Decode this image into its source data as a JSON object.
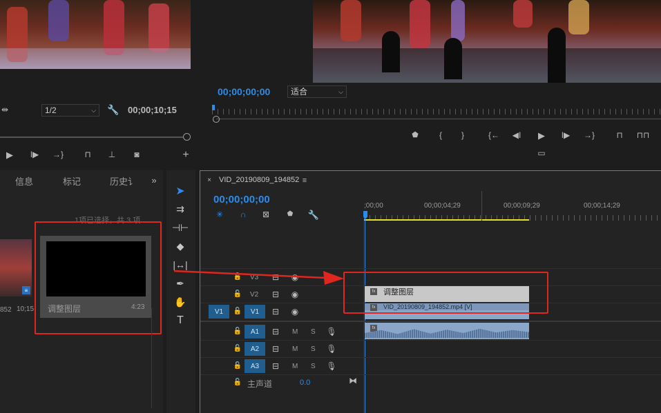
{
  "colors": {
    "accent": "#2d8ceb",
    "annotation": "#e0271f",
    "clip_grey": "#c8c8c8",
    "clip_blue": "#8aa6c8"
  },
  "source_monitor": {
    "resolution": "1/2",
    "timecode": "00;00;10;15"
  },
  "program_monitor": {
    "timecode": "00;00;00;00",
    "fit": "适合"
  },
  "project_panel": {
    "tabs": [
      "信息",
      "标记",
      "历史讠"
    ],
    "selection_status": "1项已选择，共 3 项",
    "item_prev_label": "852",
    "item_prev_duration": "10;15",
    "adjustment_layer_name": "调整图层",
    "adjustment_layer_duration": "4:23"
  },
  "timeline": {
    "sequence_name": "VID_20190809_194852",
    "timecode": "00;00;00;00",
    "ruler_labels": [
      ";00;00",
      "00;00;04;29",
      "00;00;09;29",
      "00;00;14;29"
    ],
    "tracks": {
      "v3": "V3",
      "v2": "V2",
      "v1": "V1",
      "v1_src": "V1",
      "a1": "A1",
      "a2": "A2",
      "a3": "A3",
      "m": "M",
      "s": "S",
      "master": "主声道",
      "master_value": "0.0"
    },
    "clips": {
      "adjustment": "调整图层",
      "video": "VID_20190809_194852.mp4 [V]"
    }
  },
  "icons": {
    "tools": [
      "selection-tool-icon",
      "track-select-icon",
      "ripple-edit-icon",
      "razor-icon",
      "slip-icon",
      "pen-icon",
      "hand-icon",
      "type-icon"
    ]
  }
}
